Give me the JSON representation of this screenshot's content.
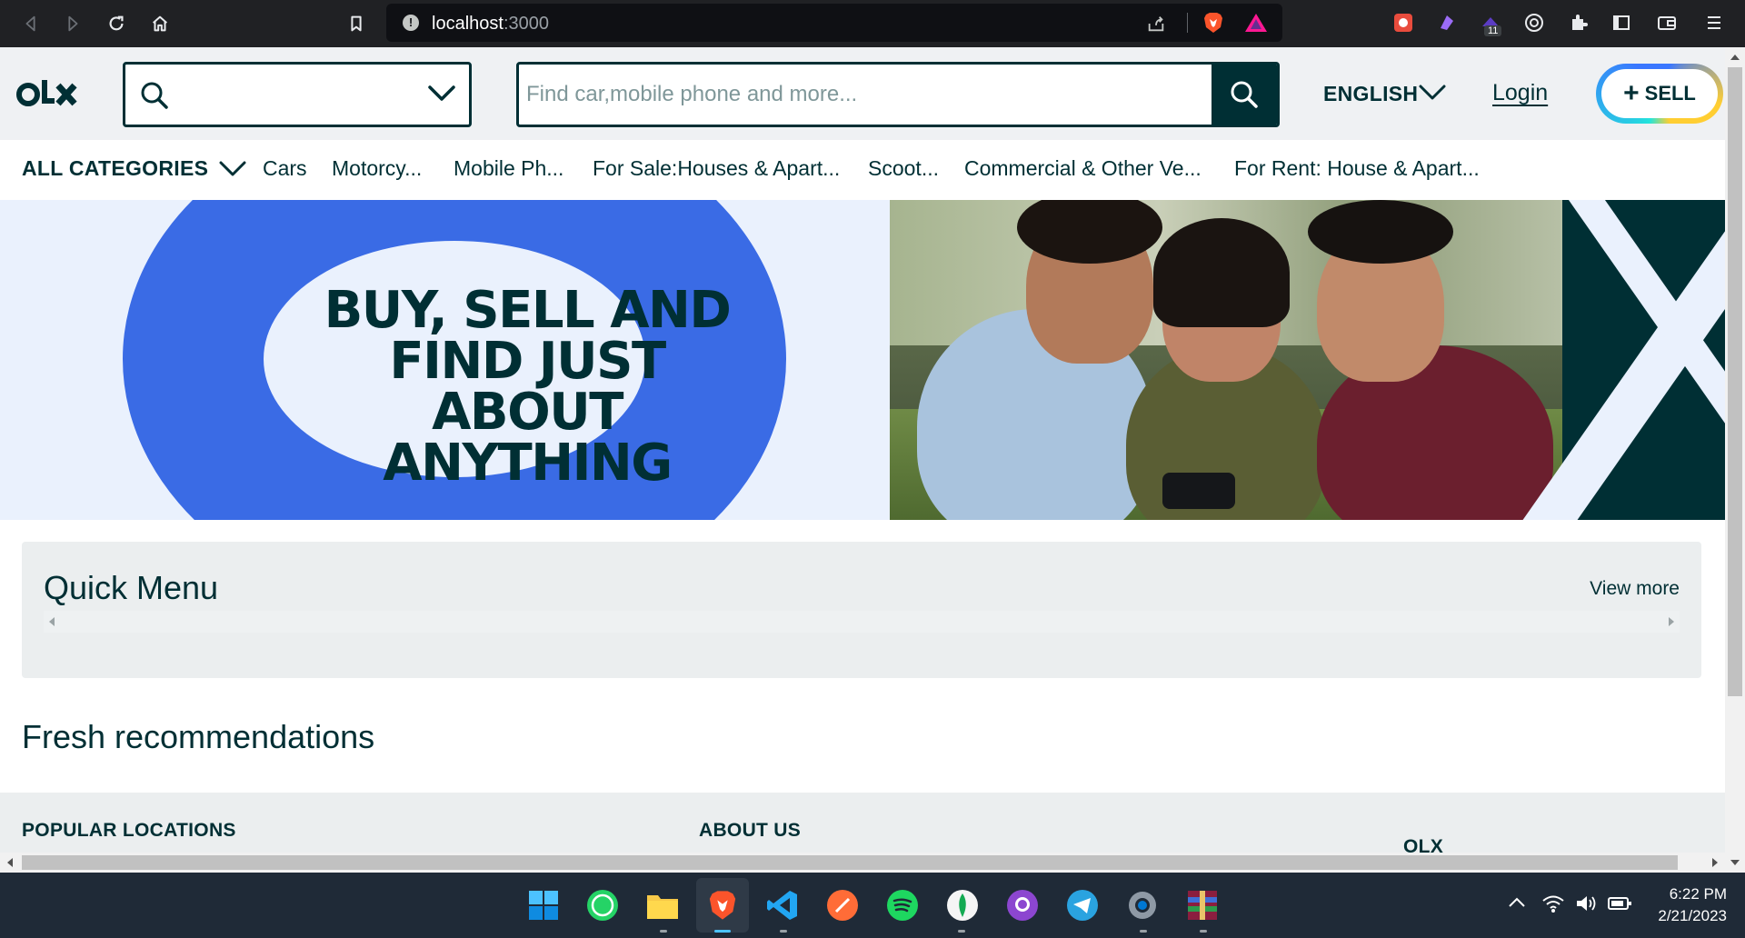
{
  "browser": {
    "url_host": "localhost",
    "url_port": ":3000",
    "extension_badge": "11"
  },
  "header": {
    "location_placeholder": "",
    "search_placeholder": "Find car,mobile phone and more...",
    "language": "ENGLISH",
    "login_label": "Login",
    "sell_label": "SELL",
    "sell_plus": "+"
  },
  "categories": {
    "all_label": "ALL CATEGORIES",
    "items": [
      "Cars",
      "Motorcy...",
      "Mobile Ph...",
      "For Sale:Houses & Apart...",
      "Scoot...",
      "Commercial & Other Ve...",
      "For Rent: House & Apart..."
    ]
  },
  "banner": {
    "line1": "BUY, SELL AND",
    "line2": "FIND JUST ABOUT",
    "line3": "ANYTHING"
  },
  "quick_menu": {
    "title": "Quick Menu",
    "view_more": "View more"
  },
  "fresh_title": "Fresh recommendations",
  "footer": {
    "popular_locations": "POPULAR LOCATIONS",
    "about_us": "ABOUT US",
    "olx": "OLX"
  },
  "taskbar": {
    "time": "6:22 PM",
    "date": "2/21/2023"
  },
  "colors": {
    "brand_dark": "#002f34",
    "banner_blue": "#3a6be5",
    "banner_bg": "#eaf1fd",
    "sell_teal": "#23e5db",
    "sell_yellow": "#ffce32"
  }
}
